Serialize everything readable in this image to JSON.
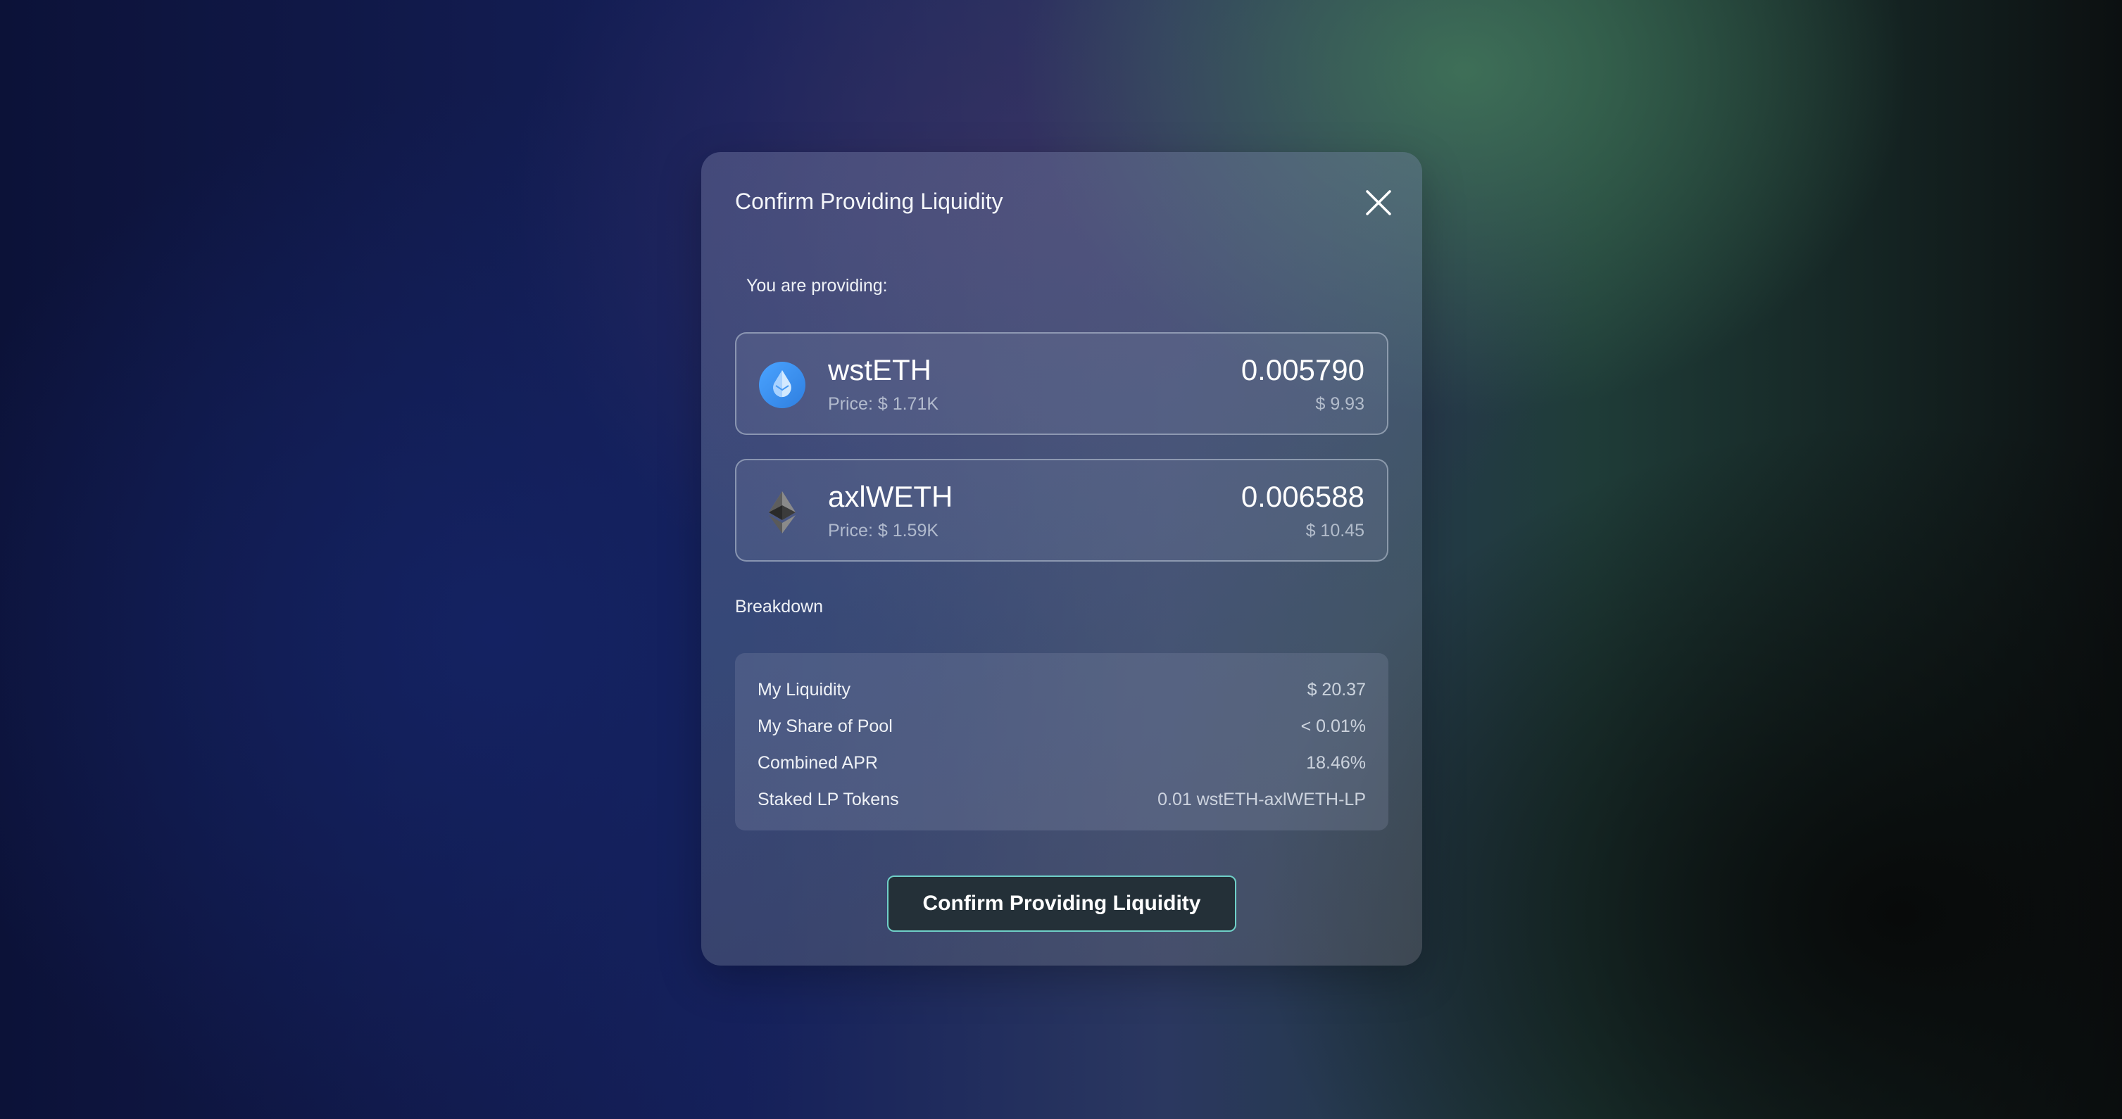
{
  "modal": {
    "title": "Confirm Providing Liquidity",
    "close_icon": "close-icon"
  },
  "providing": {
    "label": "You are providing:",
    "tokens": [
      {
        "symbol": "wstETH",
        "price": "Price: $ 1.71K",
        "amount": "0.005790",
        "value": "$ 9.93",
        "icon": "wsteth-drop-icon"
      },
      {
        "symbol": "axlWETH",
        "price": "Price: $ 1.59K",
        "amount": "0.006588",
        "value": "$ 10.45",
        "icon": "ethereum-diamond-icon"
      }
    ]
  },
  "breakdown": {
    "heading": "Breakdown",
    "rows": [
      {
        "label": "My Liquidity",
        "value": "$ 20.37"
      },
      {
        "label": "My Share of Pool",
        "value": "< 0.01%"
      },
      {
        "label": "Combined APR",
        "value": "18.46%"
      },
      {
        "label": "Staked LP Tokens",
        "value": "0.01 wstETH-axlWETH-LP"
      }
    ]
  },
  "actions": {
    "confirm_label": "Confirm Providing Liquidity"
  },
  "colors": {
    "accent_border": "#6fd0c8",
    "button_bg": "#243038",
    "wsteth_blue": "#3d8ff0"
  }
}
